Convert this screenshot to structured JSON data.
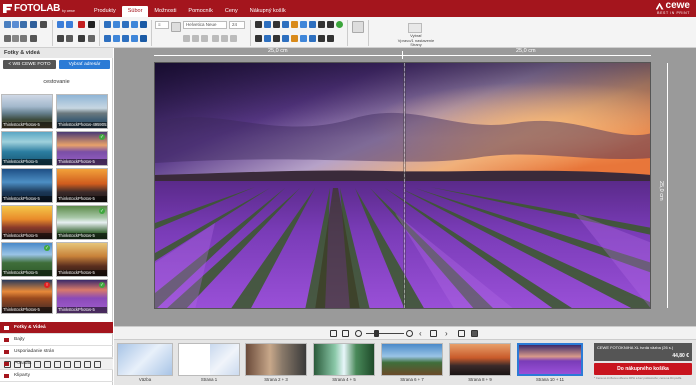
{
  "app": {
    "logo_text": "FOTOLAB",
    "logo_sub": "by cewe",
    "brand": "cewe",
    "brand_tag": "BEST IN PRINT"
  },
  "menu": {
    "tabs": [
      "Produkty",
      "Súbor",
      "Možnosti",
      "Pomocník",
      "Ceny",
      "Nákupný košík"
    ],
    "active": "Súbor"
  },
  "toolbar": {
    "font_name": "Helvetica Neue",
    "font_size": "24",
    "bg_label": "Vybrať",
    "bg_sub": "Vpravo/1 nastavenie Strany"
  },
  "sidebar": {
    "title": "Fotky & videá",
    "back_button": "< WB CEWE FOTO",
    "pick_button": "Vybrať adresár",
    "album": "cestovanie",
    "thumbs": [
      {
        "label": "ThinkstockPhotos-5",
        "badge": ""
      },
      {
        "label": "ThinkstockPhotos-495905158",
        "badge": ""
      },
      {
        "label": "ThinkstockPhoto-5",
        "badge": ""
      },
      {
        "label": "ThinkstockPhotos-5",
        "badge": "check"
      },
      {
        "label": "ThinkstockPhotos-5",
        "badge": ""
      },
      {
        "label": "ThinkstockPhotos-5",
        "badge": ""
      },
      {
        "label": "ThinkstockPhoto-5",
        "badge": ""
      },
      {
        "label": "ThinkstockPhotos-5",
        "badge": "check"
      },
      {
        "label": "ThinkstockPhoto-5",
        "badge": "check"
      },
      {
        "label": "ThinkstockPhotos-5",
        "badge": ""
      },
      {
        "label": "ThinkstockPhotos-5",
        "badge": "warn"
      },
      {
        "label": "ThinkstockPhotos-5",
        "badge": "check"
      }
    ],
    "nav": [
      "Fotky & Videá",
      "Bajty",
      "Usporiadanie strán",
      "Pozadia",
      "Kliparty"
    ]
  },
  "canvas": {
    "ruler_left": "25,0 cm",
    "ruler_right": "25,0 cm",
    "ruler_height": "25,0 cm"
  },
  "strip": {
    "pages": [
      "Väzba",
      "Strana 1",
      "Strana 2 + 3",
      "Strana 4 + 5",
      "Strana 6 + 7",
      "Strana 8 + 9",
      "Strana 10 + 11"
    ]
  },
  "order": {
    "product": "CEWE FOTOKNIHA XL tvrdá väzba (26 s.)",
    "price": "44,80 €",
    "cart_button": "Do nákupného košíka",
    "note": "* Cena so zníženou dňovou DPH a bez poštovného; cena sa líši podľa"
  },
  "colors": {
    "accent": "#a4151d",
    "selected": "#2b7bd6",
    "cart": "#c8141e"
  }
}
